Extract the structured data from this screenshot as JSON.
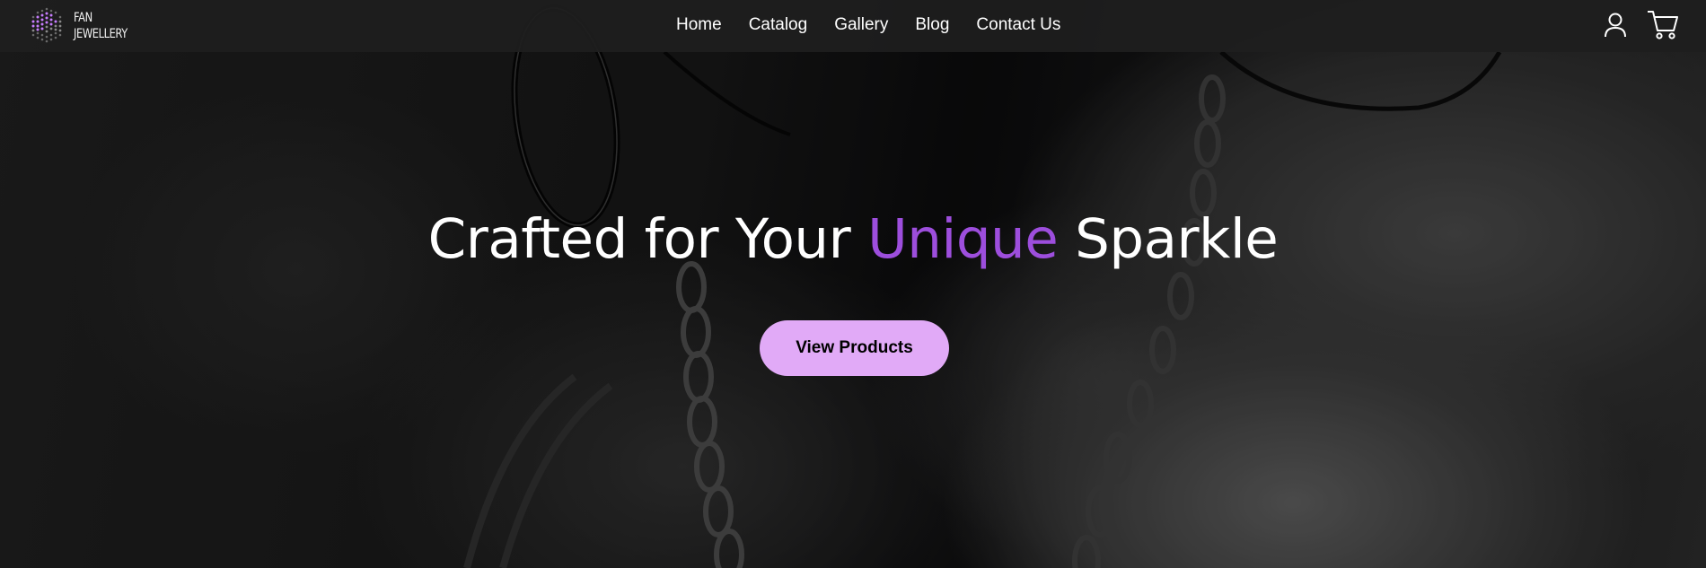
{
  "brand": {
    "name_line1": "FAN",
    "name_line2": "JEWELLERY",
    "accent_color": "#9d4edd",
    "button_color": "#e1aaf7"
  },
  "nav": {
    "items": [
      {
        "label": "Home"
      },
      {
        "label": "Catalog"
      },
      {
        "label": "Gallery"
      },
      {
        "label": "Blog"
      },
      {
        "label": "Contact Us"
      }
    ]
  },
  "header_icons": {
    "account": "user-icon",
    "cart": "cart-icon"
  },
  "hero": {
    "title_part1": "Crafted for Your ",
    "title_accent": "Unique",
    "title_part2": " Sparkle",
    "cta_label": "View Products"
  }
}
